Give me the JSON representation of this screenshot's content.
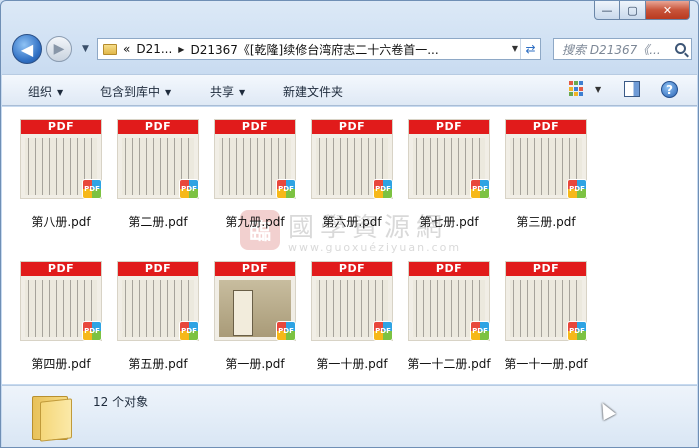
{
  "window": {
    "minimize_label": "—",
    "maximize_label": "▢",
    "close_label": "✕"
  },
  "nav": {
    "back_glyph": "◀",
    "forward_glyph": "▶",
    "dropdown_glyph": "▼",
    "breadcrumb_overflow": "«",
    "breadcrumb": [
      "D21...",
      "D21367《[乾隆]续修台湾府志二十六卷首一..."
    ],
    "breadcrumb_sep": "▶",
    "refresh_glyph": "⇄",
    "search_placeholder": "搜索 D21367《..."
  },
  "toolbar": {
    "organize": "组织",
    "include_in_library": "包含到库中",
    "share": "共享",
    "new_folder": "新建文件夹",
    "dropdown_glyph": "▼",
    "help_glyph": "?"
  },
  "thumb_banner": "PDF",
  "badge_text": "PDF",
  "files_row1": [
    {
      "name": "第八册.pdf"
    },
    {
      "name": "第二册.pdf"
    },
    {
      "name": "第九册.pdf"
    },
    {
      "name": "第六册.pdf"
    },
    {
      "name": "第七册.pdf"
    },
    {
      "name": "第三册.pdf"
    }
  ],
  "files_row2": [
    {
      "name": "第四册.pdf"
    },
    {
      "name": "第五册.pdf"
    },
    {
      "name": "第一册.pdf",
      "cover": true
    },
    {
      "name": "第一十册.pdf"
    },
    {
      "name": "第一十二册.pdf"
    },
    {
      "name": "第一十一册.pdf"
    }
  ],
  "watermark": {
    "seal": "臨",
    "title": "國學資源網",
    "url": "www.guoxuéziyuan.com"
  },
  "status": {
    "count_text": "12 个对象"
  },
  "colors": {
    "pdf_red": "#e11b1b",
    "accent_blue": "#2f6fc3"
  }
}
